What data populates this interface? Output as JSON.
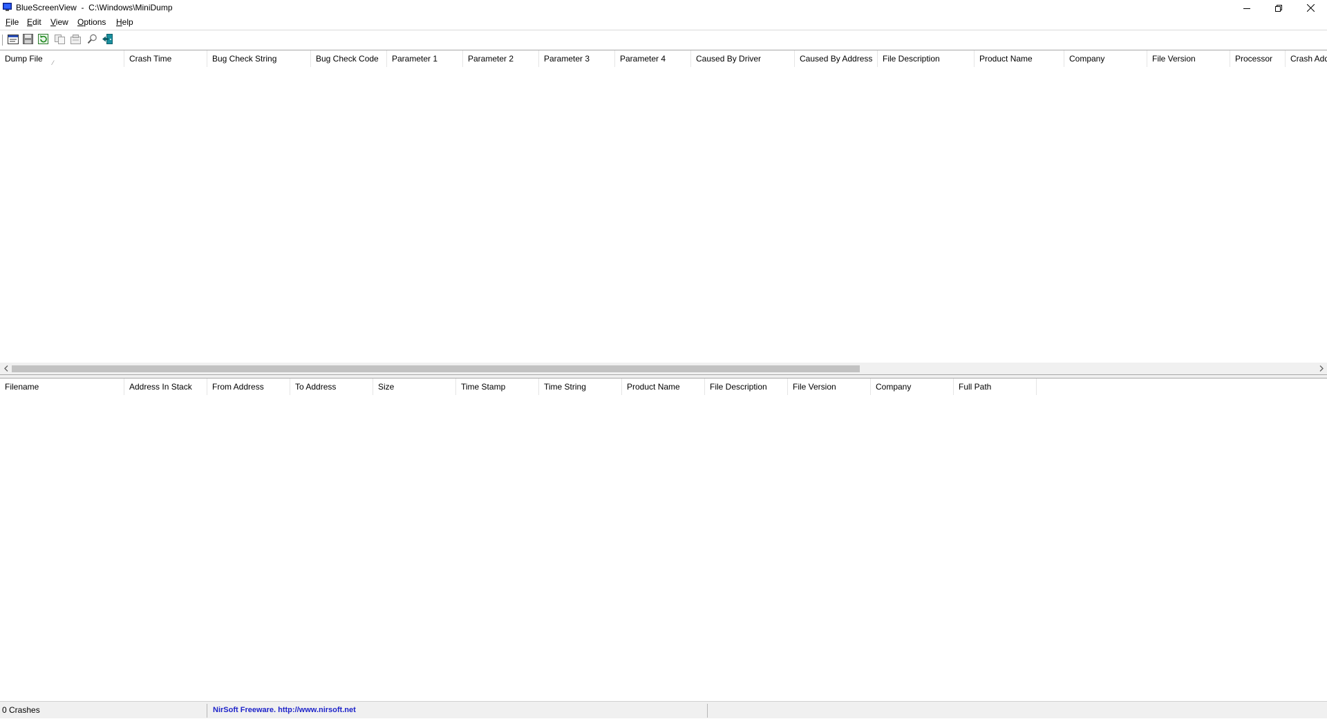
{
  "window": {
    "title": "BlueScreenView  -  C:\\Windows\\MiniDump",
    "app_icon": "bluescreen-monitor-icon",
    "controls": [
      "minimize-icon",
      "restore-icon",
      "close-icon"
    ]
  },
  "menu": [
    {
      "first": "F",
      "rest": "ile"
    },
    {
      "first": "E",
      "rest": "dit"
    },
    {
      "first": "V",
      "rest": "iew"
    },
    {
      "first": "O",
      "rest": "ptions"
    },
    {
      "first": "H",
      "rest": "elp"
    }
  ],
  "toolbar": {
    "buttons": [
      "properties-icon",
      "save-icon",
      "refresh-icon",
      "copy-icon",
      "advanced-options-icon",
      "find-icon",
      "exit-icon"
    ]
  },
  "crash_list": {
    "columns": [
      "Dump File",
      "Crash Time",
      "Bug Check String",
      "Bug Check Code",
      "Parameter 1",
      "Parameter 2",
      "Parameter 3",
      "Parameter 4",
      "Caused By Driver",
      "Caused By Address",
      "File Description",
      "Product Name",
      "Company",
      "File Version",
      "Processor",
      "Crash Add"
    ],
    "sorted_column": "Dump File",
    "sort_indicator": "⁄",
    "rows": []
  },
  "driver_list": {
    "columns": [
      "Filename",
      "Address In Stack",
      "From Address",
      "To Address",
      "Size",
      "Time Stamp",
      "Time String",
      "Product Name",
      "File Description",
      "File Version",
      "Company",
      "Full Path"
    ],
    "rows": []
  },
  "status": {
    "crash_count": "0 Crashes",
    "credit": "NirSoft Freeware.  http://www.nirsoft.net"
  }
}
